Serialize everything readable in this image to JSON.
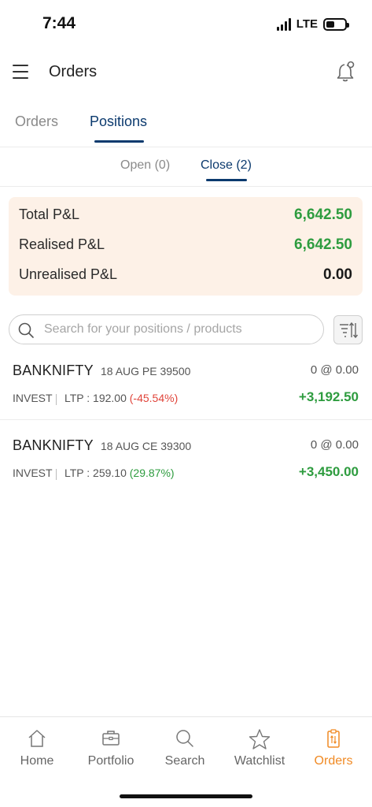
{
  "status": {
    "time": "7:44",
    "network": "LTE",
    "battery_level": 0.45
  },
  "header": {
    "title": "Orders"
  },
  "tabs": [
    {
      "label": "Orders",
      "active": false
    },
    {
      "label": "Positions",
      "active": true
    }
  ],
  "subtabs": [
    {
      "label": "Open (0)",
      "active": false
    },
    {
      "label": "Close (2)",
      "active": true
    }
  ],
  "pnl": {
    "total_label": "Total P&L",
    "total_value": "6,642.50",
    "realised_label": "Realised P&L",
    "realised_value": "6,642.50",
    "unrealised_label": "Unrealised P&L",
    "unrealised_value": "0.00"
  },
  "search": {
    "placeholder": "Search for your positions / products"
  },
  "positions": [
    {
      "symbol": "BANKNIFTY",
      "contract": "18 AUG PE 39500",
      "qty": "0 @ 0.00",
      "product": "INVEST",
      "ltp": "LTP : 192.00",
      "change": "(-45.54%)",
      "change_color": "#e0443a",
      "pnl": "+3,192.50"
    },
    {
      "symbol": "BANKNIFTY",
      "contract": "18 AUG CE 39300",
      "qty": "0 @ 0.00",
      "product": "INVEST",
      "ltp": "LTP : 259.10",
      "change": "(29.87%)",
      "change_color": "#2e9c3f",
      "pnl": "+3,450.00"
    }
  ],
  "nav": [
    {
      "label": "Home",
      "icon": "home-icon"
    },
    {
      "label": "Portfolio",
      "icon": "briefcase-icon"
    },
    {
      "label": "Search",
      "icon": "search-icon"
    },
    {
      "label": "Watchlist",
      "icon": "star-icon"
    },
    {
      "label": "Orders",
      "icon": "orders-icon",
      "active": true
    }
  ],
  "colors": {
    "accent": "#0b3a6e",
    "active_nav": "#f08a24",
    "profit": "#2e9c3f",
    "loss": "#e0443a",
    "card_bg": "#fdf1e7"
  }
}
